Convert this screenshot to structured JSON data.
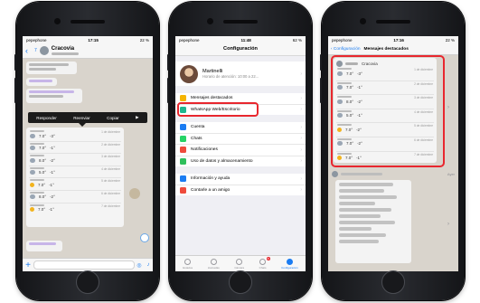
{
  "phone1": {
    "carrier": "pepephone",
    "time": "17:15",
    "battery": "22 %",
    "contact_title": "Cracovia",
    "context_menu": [
      "Responder",
      "Reenviar",
      "Copiar"
    ],
    "more_arrow": "▶",
    "forecast_rows": [
      {
        "temp_hi": "7.0°",
        "temp_lo": "-3°",
        "date": "1 de diciembre",
        "icon": "cloud-icon"
      },
      {
        "temp_hi": "7.0°",
        "temp_lo": "-1°",
        "date": "2 de diciembre",
        "icon": "cloud-icon"
      },
      {
        "temp_hi": "8.0°",
        "temp_lo": "-2°",
        "date": "3 de diciembre",
        "icon": "cloud-icon"
      },
      {
        "temp_hi": "5.0°",
        "temp_lo": "-1°",
        "date": "4 de diciembre",
        "icon": "cloud-icon"
      },
      {
        "temp_hi": "7.0°",
        "temp_lo": "-1°",
        "date": "5 de diciembre",
        "icon": "sun-icon"
      },
      {
        "temp_hi": "8.0°",
        "temp_lo": "-2°",
        "date": "6 de diciembre",
        "icon": "cloud-icon"
      },
      {
        "temp_hi": "7.0°",
        "temp_lo": "-1°",
        "date": "7 de diciembre",
        "icon": "sun-icon"
      }
    ]
  },
  "phone2": {
    "carrier": "pepephone",
    "time": "11:48",
    "battery": "62 %",
    "title": "Configuración",
    "profile_name": "Martinelli",
    "profile_status": "Horario de atención: 10:00 a 22...",
    "group1": [
      {
        "label": "Mensajes destacados",
        "color": "#f5b400"
      },
      {
        "label": "WhatsApp Web/Escritorio",
        "color": "#1fb78f"
      }
    ],
    "group2": [
      {
        "label": "Cuenta",
        "color": "#1a7cf2"
      },
      {
        "label": "Chats",
        "color": "#25d366"
      },
      {
        "label": "Notificaciones",
        "color": "#ef4b3c"
      },
      {
        "label": "Uso de datos y almacenamiento",
        "color": "#2fbf5c"
      }
    ],
    "group3": [
      {
        "label": "Información y ayuda",
        "color": "#1a7cf2"
      },
      {
        "label": "Contarle a un amigo",
        "color": "#ef4b3c"
      }
    ],
    "tabs": [
      {
        "label": "Estados",
        "badge": ""
      },
      {
        "label": "Llamadas",
        "badge": ""
      },
      {
        "label": "Cámara",
        "badge": ""
      },
      {
        "label": "Chats",
        "badge": "5"
      },
      {
        "label": "Configuración",
        "badge": ""
      }
    ]
  },
  "phone3": {
    "carrier": "pepephone",
    "time": "17:16",
    "battery": "22 %",
    "back_label": "‹ Configuración",
    "title": "Mensajes destacados",
    "card_contact": "Cracovia",
    "forecast_rows": [
      {
        "temp_hi": "7.0°",
        "temp_lo": "-3°",
        "date": "1 de diciembre",
        "icon": "cloud-icon"
      },
      {
        "temp_hi": "7.0°",
        "temp_lo": "-1°",
        "date": "2 de diciembre",
        "icon": "cloud-icon"
      },
      {
        "temp_hi": "8.0°",
        "temp_lo": "-2°",
        "date": "3 de diciembre",
        "icon": "cloud-icon"
      },
      {
        "temp_hi": "5.0°",
        "temp_lo": "-1°",
        "date": "4 de diciembre",
        "icon": "cloud-icon"
      },
      {
        "temp_hi": "7.0°",
        "temp_lo": "-2°",
        "date": "5 de diciembre",
        "icon": "sun-icon"
      },
      {
        "temp_hi": "7.0°",
        "temp_lo": "-2°",
        "date": "6 de diciembre",
        "icon": "cloud-icon"
      },
      {
        "temp_hi": "7.0°",
        "temp_lo": "-1°",
        "date": "7 de diciembre",
        "icon": "sun-icon"
      }
    ],
    "second_item_time": "Ayer"
  },
  "colors": {
    "accent": "#1a7cf2",
    "highlight_red": "#e8272e"
  }
}
